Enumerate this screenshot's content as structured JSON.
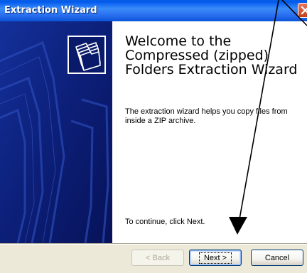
{
  "window": {
    "title": "Extraction Wizard"
  },
  "icons": {
    "close": "close-icon",
    "folders": "zip-folders-icon"
  },
  "colors": {
    "titlebar": "#0058ee",
    "sidebar": "#0a1a6a",
    "close_button": "#d6532f",
    "annotation_arrow": "#000000"
  },
  "content": {
    "heading": "Welcome to the Compressed (zipped) Folders Extraction Wizard",
    "description": "The extraction wizard helps you copy files from inside a ZIP archive.",
    "continue_text": "To continue, click Next."
  },
  "buttons": {
    "back": "< Back",
    "next": "Next >",
    "cancel": "Cancel"
  }
}
